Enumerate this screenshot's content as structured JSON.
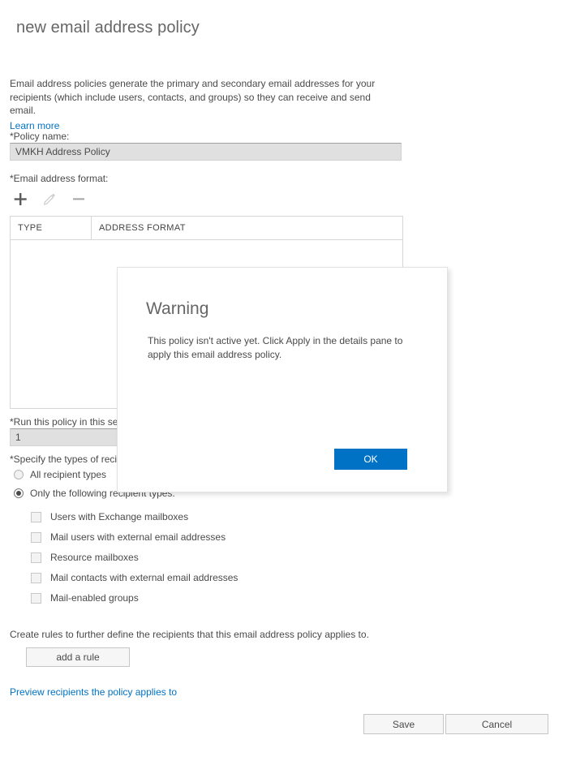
{
  "page": {
    "title": "new email address policy",
    "intro": "Email address policies generate the primary and secondary email addresses for your recipients (which include users, contacts, and groups) so they can receive and send email.",
    "learn_more": "Learn more"
  },
  "policy_name": {
    "label": "*Policy name:",
    "value": "VMKH Address Policy"
  },
  "email_format": {
    "label": "*Email address format:",
    "toolbar": {
      "add": "add-icon",
      "edit": "edit-icon",
      "remove": "remove-icon"
    },
    "columns": [
      "TYPE",
      "ADDRESS FORMAT"
    ],
    "rows": []
  },
  "sequence": {
    "label": "*Run this policy in this sequence:",
    "value": "1"
  },
  "recipient_types": {
    "label": "*Specify the types of recipients:",
    "options": [
      {
        "label": "All recipient types",
        "selected": false
      },
      {
        "label": "Only the following recipient types:",
        "selected": true
      }
    ],
    "checkboxes": [
      {
        "label": "Users with Exchange mailboxes",
        "checked": false
      },
      {
        "label": "Mail users with external email addresses",
        "checked": false
      },
      {
        "label": "Resource mailboxes",
        "checked": false
      },
      {
        "label": "Mail contacts with external email addresses",
        "checked": false
      },
      {
        "label": "Mail-enabled groups",
        "checked": false
      }
    ]
  },
  "rules": {
    "description": "Create rules to further define the recipients that this email address policy applies to.",
    "add_rule_label": "add a rule",
    "preview_link": "Preview recipients the policy applies to"
  },
  "footer": {
    "save_label": "Save",
    "cancel_label": "Cancel"
  },
  "dialog": {
    "title": "Warning",
    "message": "This policy isn't active yet. Click Apply in the details pane to apply this email address policy.",
    "ok_label": "OK"
  },
  "colors": {
    "accent": "#0072c6",
    "link": "#0072c6",
    "text": "#4a4a4a",
    "heading": "#666666",
    "input_bg": "#e0e0e0",
    "border": "#d6d6d6"
  }
}
